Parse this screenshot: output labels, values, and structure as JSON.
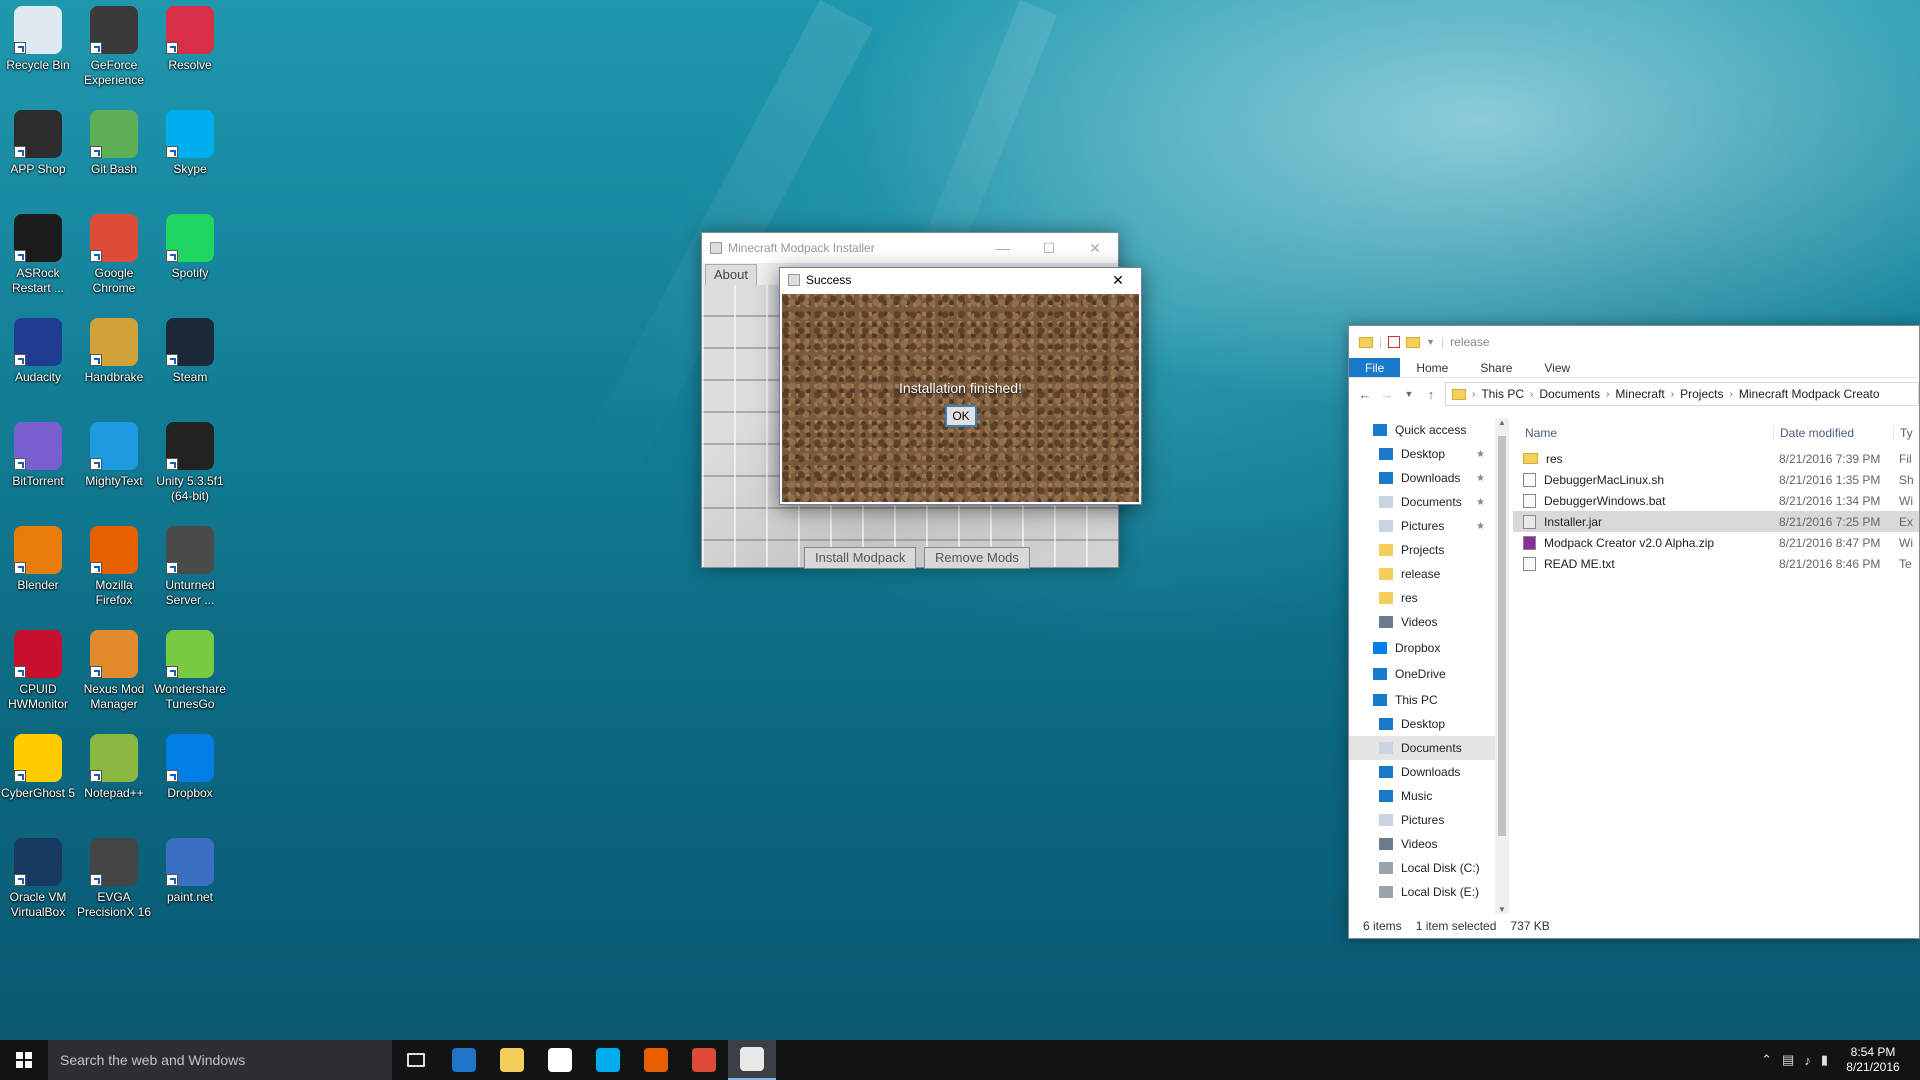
{
  "desktop": {
    "icons": [
      {
        "label": "Recycle Bin",
        "icon": "recycle-bin-icon",
        "color": "#dfe9f2"
      },
      {
        "label": "GeForce Experience",
        "icon": "nvidia-icon",
        "color": "#3a3a3a"
      },
      {
        "label": "Resolve",
        "icon": "resolve-icon",
        "color": "#d92f46"
      },
      {
        "label": "APP Shop",
        "icon": "app-shop-icon",
        "color": "#2c2c2c"
      },
      {
        "label": "Git Bash",
        "icon": "git-bash-icon",
        "color": "#5fae58"
      },
      {
        "label": "Skype",
        "icon": "skype-icon",
        "color": "#00aff0"
      },
      {
        "label": "ASRock Restart ...",
        "icon": "uefi-icon",
        "color": "#1b1b1b"
      },
      {
        "label": "Google Chrome",
        "icon": "chrome-icon",
        "color": "#dd4b39"
      },
      {
        "label": "Spotify",
        "icon": "spotify-icon",
        "color": "#1ed760"
      },
      {
        "label": "Audacity",
        "icon": "audacity-icon",
        "color": "#1f3b8f"
      },
      {
        "label": "Handbrake",
        "icon": "handbrake-icon",
        "color": "#d2a23a"
      },
      {
        "label": "Steam",
        "icon": "steam-icon",
        "color": "#1b2838"
      },
      {
        "label": "BitTorrent",
        "icon": "bittorrent-icon",
        "color": "#7a5fd1"
      },
      {
        "label": "MightyText",
        "icon": "mightytext-icon",
        "color": "#1e9ae0"
      },
      {
        "label": "Unity 5.3.5f1 (64-bit)",
        "icon": "unity-icon",
        "color": "#222222"
      },
      {
        "label": "Blender",
        "icon": "blender-icon",
        "color": "#e87d0d"
      },
      {
        "label": "Mozilla Firefox",
        "icon": "firefox-icon",
        "color": "#e66000"
      },
      {
        "label": "Unturned Server ...",
        "icon": "unturned-icon",
        "color": "#4a4a4a"
      },
      {
        "label": "CPUID HWMonitor",
        "icon": "hwmonitor-icon",
        "color": "#c8102e"
      },
      {
        "label": "Nexus Mod Manager",
        "icon": "nexus-icon",
        "color": "#e38b2c"
      },
      {
        "label": "Wondershare TunesGo",
        "icon": "tunesgo-icon",
        "color": "#7ac943"
      },
      {
        "label": "CyberGhost 5",
        "icon": "cyberghost-icon",
        "color": "#ffcc00"
      },
      {
        "label": "Notepad++",
        "icon": "notepad-plus-icon",
        "color": "#8ab843"
      },
      {
        "label": "Dropbox",
        "icon": "dropbox-icon",
        "color": "#007ee5"
      },
      {
        "label": "Oracle VM VirtualBox",
        "icon": "virtualbox-icon",
        "color": "#183a61"
      },
      {
        "label": "EVGA PrecisionX 16",
        "icon": "evga-icon",
        "color": "#444444"
      },
      {
        "label": "paint.net",
        "icon": "paintnet-icon",
        "color": "#3a6fc4"
      }
    ]
  },
  "installer": {
    "title": "Minecraft Modpack Installer",
    "about": "About",
    "install_btn": "Install Modpack",
    "remove_btn": "Remove Mods"
  },
  "dialog": {
    "title": "Success",
    "message": "Installation finished!",
    "ok": "OK"
  },
  "explorer": {
    "title": "release",
    "tabs": [
      "File",
      "Home",
      "Share",
      "View"
    ],
    "breadcrumb": [
      "This PC",
      "Documents",
      "Minecraft",
      "Projects",
      "Minecraft Modpack Creato"
    ],
    "nav": [
      {
        "label": "Quick access",
        "level": 1,
        "icon": "star-icon",
        "pinned": false
      },
      {
        "label": "Desktop",
        "level": 2,
        "icon": "desktop-icon",
        "pinned": true
      },
      {
        "label": "Downloads",
        "level": 2,
        "icon": "downloads-icon",
        "pinned": true
      },
      {
        "label": "Documents",
        "level": 2,
        "icon": "documents-icon",
        "pinned": true
      },
      {
        "label": "Pictures",
        "level": 2,
        "icon": "pictures-icon",
        "pinned": true
      },
      {
        "label": "Projects",
        "level": 2,
        "icon": "folder-icon",
        "pinned": false
      },
      {
        "label": "release",
        "level": 2,
        "icon": "folder-icon",
        "pinned": false
      },
      {
        "label": "res",
        "level": 2,
        "icon": "folder-icon",
        "pinned": false
      },
      {
        "label": "Videos",
        "level": 2,
        "icon": "videos-icon",
        "pinned": false
      },
      {
        "label": "Dropbox",
        "level": 1,
        "icon": "dropbox-icon",
        "pinned": false
      },
      {
        "label": "OneDrive",
        "level": 1,
        "icon": "onedrive-icon",
        "pinned": false
      },
      {
        "label": "This PC",
        "level": 1,
        "icon": "computer-icon",
        "pinned": false
      },
      {
        "label": "Desktop",
        "level": 2,
        "icon": "desktop-icon",
        "pinned": false
      },
      {
        "label": "Documents",
        "level": 2,
        "icon": "documents-icon",
        "pinned": false,
        "selected": true
      },
      {
        "label": "Downloads",
        "level": 2,
        "icon": "downloads-icon",
        "pinned": false
      },
      {
        "label": "Music",
        "level": 2,
        "icon": "music-icon",
        "pinned": false
      },
      {
        "label": "Pictures",
        "level": 2,
        "icon": "pictures-icon",
        "pinned": false
      },
      {
        "label": "Videos",
        "level": 2,
        "icon": "videos-icon",
        "pinned": false
      },
      {
        "label": "Local Disk (C:)",
        "level": 2,
        "icon": "disk-icon",
        "pinned": false
      },
      {
        "label": "Local Disk (E:)",
        "level": 2,
        "icon": "disk-icon",
        "pinned": false
      }
    ],
    "columns": {
      "name": "Name",
      "date": "Date modified",
      "type": "Ty"
    },
    "files": [
      {
        "name": "res",
        "date": "8/21/2016 7:39 PM",
        "type": "Fil",
        "kind": "folder"
      },
      {
        "name": "DebuggerMacLinux.sh",
        "date": "8/21/2016 1:35 PM",
        "type": "Sh",
        "kind": "file"
      },
      {
        "name": "DebuggerWindows.bat",
        "date": "8/21/2016 1:34 PM",
        "type": "Wi",
        "kind": "file"
      },
      {
        "name": "Installer.jar",
        "date": "8/21/2016 7:25 PM",
        "type": "Ex",
        "kind": "jar",
        "selected": true
      },
      {
        "name": "Modpack Creator v2.0 Alpha.zip",
        "date": "8/21/2016 8:47 PM",
        "type": "Wi",
        "kind": "zip"
      },
      {
        "name": "READ ME.txt",
        "date": "8/21/2016 8:46 PM",
        "type": "Te",
        "kind": "file"
      }
    ],
    "status": {
      "items": "6 items",
      "selected": "1 item selected",
      "size": "737 KB"
    }
  },
  "taskbar": {
    "search_placeholder": "Search the web and Windows",
    "apps": [
      {
        "icon": "task-view-icon",
        "color": "#101417"
      },
      {
        "icon": "edge-icon",
        "color": "#1e74c6"
      },
      {
        "icon": "file-explorer-icon",
        "color": "#f5cf5c"
      },
      {
        "icon": "store-icon",
        "color": "#ffffff"
      },
      {
        "icon": "skype-icon",
        "color": "#00aff0"
      },
      {
        "icon": "firefox-icon",
        "color": "#e66000"
      },
      {
        "icon": "chrome-icon",
        "color": "#dd4b39"
      },
      {
        "icon": "java-icon",
        "color": "#e8e8e8",
        "active": true
      }
    ],
    "time": "8:54 PM",
    "date": "8/21/2016"
  }
}
